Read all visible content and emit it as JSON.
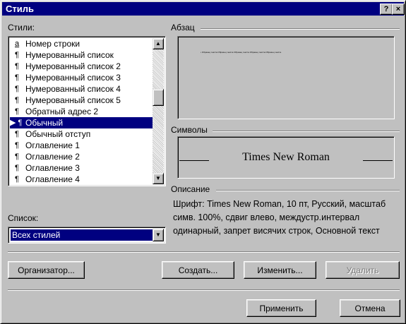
{
  "window": {
    "title": "Стиль",
    "help_btn": "?",
    "close_btn": "×"
  },
  "styles": {
    "label": "Стили:",
    "items": [
      {
        "mark": "a",
        "text": "Номер строки"
      },
      {
        "mark": "¶",
        "text": "Нумерованный список"
      },
      {
        "mark": "¶",
        "text": "Нумерованный список 2"
      },
      {
        "mark": "¶",
        "text": "Нумерованный список 3"
      },
      {
        "mark": "¶",
        "text": "Нумерованный список 4"
      },
      {
        "mark": "¶",
        "text": "Нумерованный список 5"
      },
      {
        "mark": "¶",
        "text": "Обратный адрес 2"
      },
      {
        "mark": "▶ ¶",
        "text": "Обычный",
        "selected": true
      },
      {
        "mark": "¶",
        "text": "Обычный отступ"
      },
      {
        "mark": "¶",
        "text": "Оглавление 1"
      },
      {
        "mark": "¶",
        "text": "Оглавление 2"
      },
      {
        "mark": "¶",
        "text": "Оглавление 3"
      },
      {
        "mark": "¶",
        "text": "Оглавление 4"
      }
    ]
  },
  "list": {
    "label": "Список:",
    "selected": "Всех стилей"
  },
  "paragraph": {
    "label": "Абзац",
    "preview_text": "• Образец текста Образец текста Образец текста Образец текста Образец текста"
  },
  "symbols": {
    "label": "Символы",
    "font_preview": "Times New Roman"
  },
  "description": {
    "label": "Описание",
    "text": "Шрифт: Times New Roman, 10 пт, Русский, масштаб симв. 100%, сдвиг влево, междустр.интервал одинарный, запрет висячих строк, Основной текст"
  },
  "buttons": {
    "organizer": "Организатор...",
    "create": "Создать...",
    "modify": "Изменить...",
    "delete": "Удалить",
    "apply": "Применить",
    "cancel": "Отмена"
  }
}
